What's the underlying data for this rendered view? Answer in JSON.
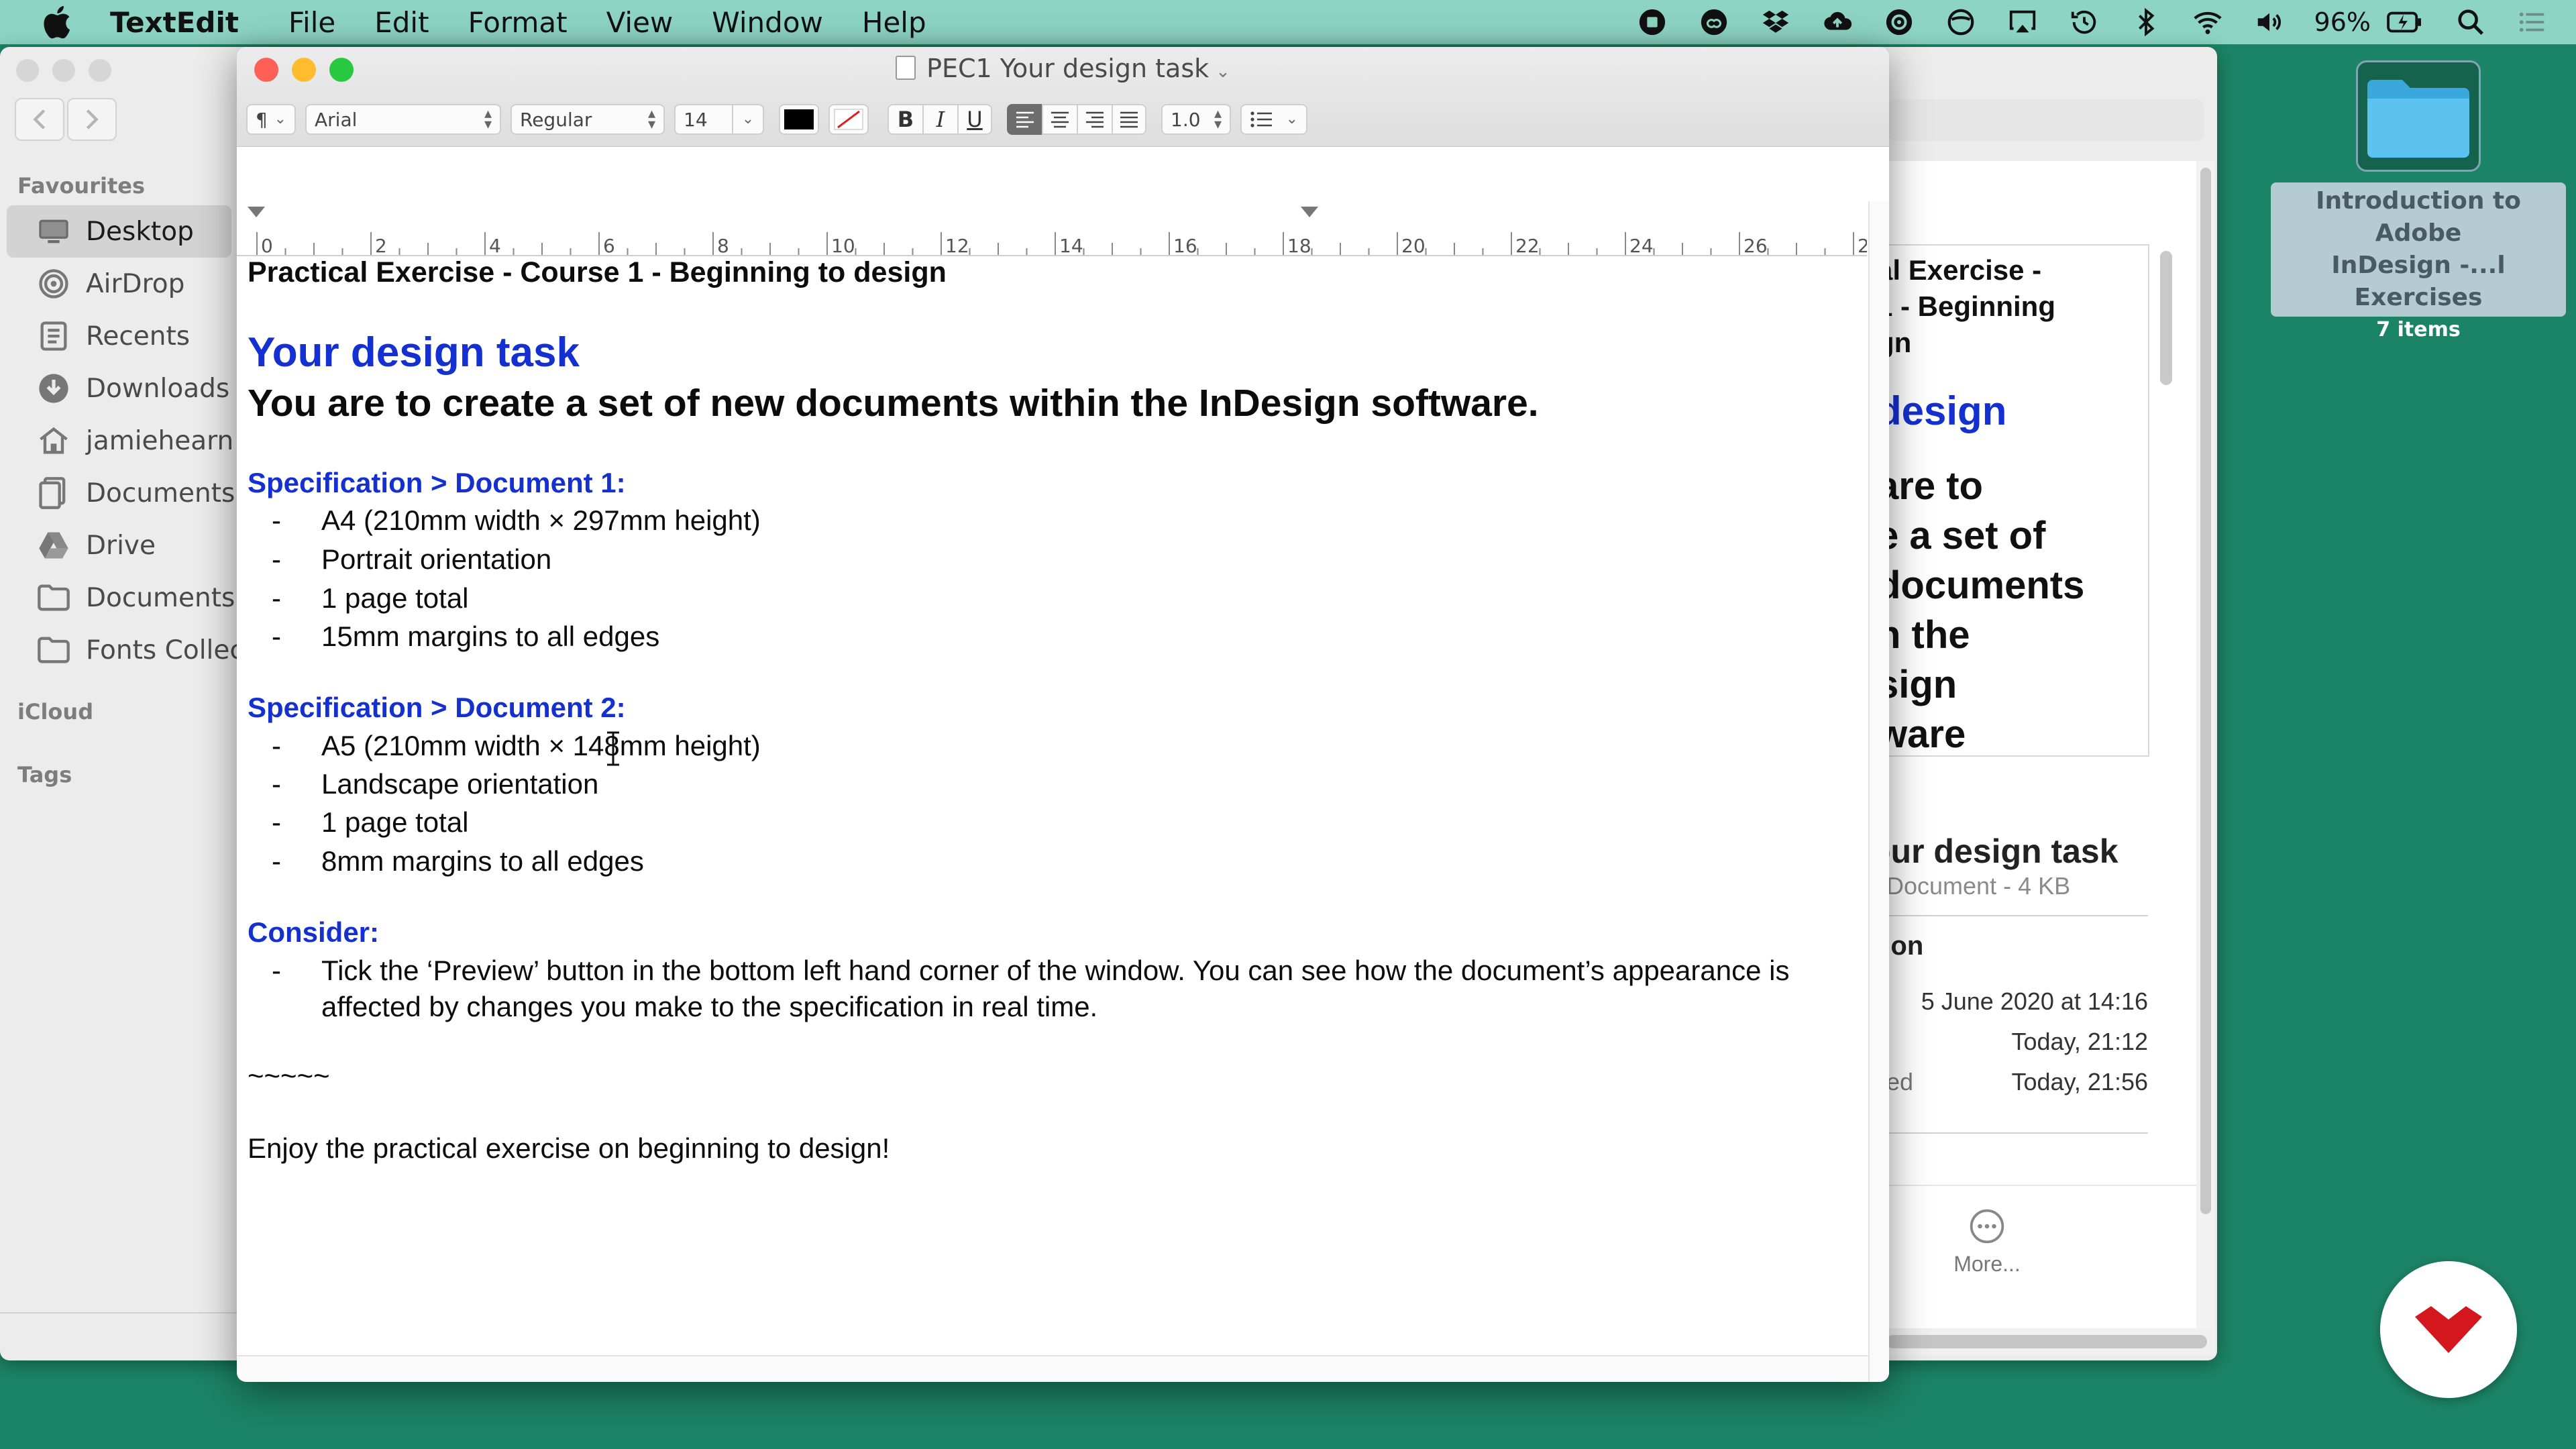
{
  "menubar": {
    "app": "TextEdit",
    "items": [
      "File",
      "Edit",
      "Format",
      "View",
      "Window",
      "Help"
    ],
    "battery_percent": "96%"
  },
  "finder": {
    "sidebar": {
      "favourites_heading": "Favourites",
      "items": [
        "Desktop",
        "AirDrop",
        "Recents",
        "Downloads",
        "jamiehearn",
        "Documents",
        "Drive",
        "Documents",
        "Fonts Collect"
      ],
      "icloud_heading": "iCloud",
      "tags_heading": "Tags"
    },
    "preview": {
      "thumb_line1": "al Exercise -\n1 - Beginning\ngn",
      "thumb_line2": "design",
      "thumb_line3": "are to\ne a set of\ndocuments\nn the\nsign\nware",
      "title": "our design task",
      "subtitle": "Document - 4 KB",
      "info_heading": "tion",
      "rows": [
        {
          "key": "",
          "value": "5 June 2020 at 14:16"
        },
        {
          "key": "",
          "value": "Today, 21:12"
        },
        {
          "key": "ed",
          "value": "Today, 21:56"
        }
      ],
      "more_label": "More..."
    }
  },
  "textedit": {
    "window_title": "PEC1 Your design task",
    "toolbar": {
      "paragraph_symbol": "¶",
      "font_family": "Arial",
      "font_style": "Regular",
      "font_size": "14",
      "bold": "B",
      "italic": "I",
      "underline": "U",
      "line_spacing": "1.0"
    },
    "ruler_labels": [
      "0",
      "2",
      "4",
      "6",
      "8",
      "10",
      "12",
      "14",
      "16",
      "18",
      "20",
      "22",
      "24",
      "26",
      "2"
    ],
    "document": {
      "heading_top": "Practical Exercise - Course 1 - Beginning to design",
      "heading_blue": "Your design task",
      "heading_big": "You are to create a set of new documents within the InDesign software.",
      "spec1_heading": "Specification > Document 1:",
      "spec1_items": [
        "A4 (210mm width × 297mm height)",
        "Portrait orientation",
        "1 page total",
        "15mm margins to all edges"
      ],
      "spec2_heading": "Specification > Document 2:",
      "spec2_items": [
        "A5 (210mm width × 148mm height)",
        "Landscape orientation",
        "1 page total",
        "8mm margins to all edges"
      ],
      "consider_heading": "Consider:",
      "consider_line1": "Tick the ‘Preview’ button in the bottom left hand corner of the window. You can see how the document’s appearance is",
      "consider_line2": "affected by changes you make to the specification in real time.",
      "divider": "~~~~~",
      "closing": "Enjoy the practical exercise on beginning to design!",
      "bullet": "-"
    }
  },
  "desktop": {
    "folder_label_line1": "Introduction to Adobe",
    "folder_label_line2": "InDesign -...l Exercises",
    "folder_count": "7 items"
  },
  "colors": {
    "desktop": "#1c8466",
    "menubar": "#8dd4c4",
    "heading_blue": "#1530d0"
  }
}
